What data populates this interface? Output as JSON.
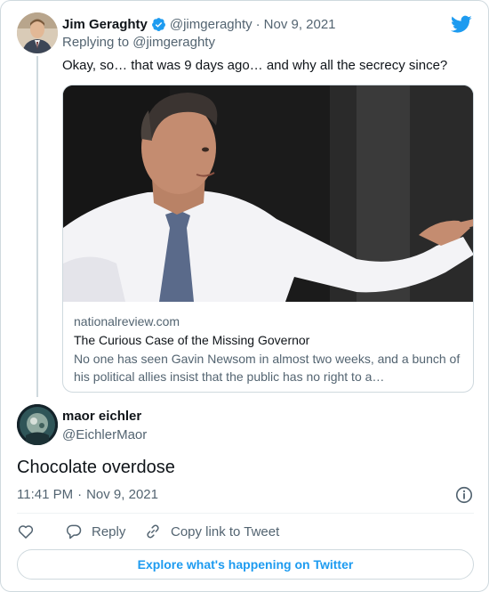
{
  "parent_tweet": {
    "author_name": "Jim Geraghty",
    "author_handle": "@jimgeraghty",
    "separator": "·",
    "date": "Nov 9, 2021",
    "replying_to": "Replying to @jimgeraghty",
    "text": "Okay, so… that was 9 days ago… and why all the secrecy since?",
    "link_card": {
      "domain": "nationalreview.com",
      "title": "The Curious Case of the Missing Governor",
      "description": "No one has seen Gavin Newsom in almost two weeks, and a bunch of his political allies insist that the public has no right to a…"
    }
  },
  "tweet": {
    "author_name": "maor eichler",
    "author_handle": "@EichlerMaor",
    "text": "Chocolate overdose",
    "time": "11:41 PM",
    "separator": "·",
    "date": "Nov 9, 2021"
  },
  "actions": {
    "reply_label": "Reply",
    "copy_label": "Copy link to Tweet"
  },
  "explore_label": "Explore what's happening on Twitter",
  "icons": [
    "twitter-logo-icon",
    "verified-badge-icon",
    "info-icon",
    "heart-icon",
    "reply-bubble-icon",
    "link-icon"
  ],
  "colors": {
    "brand_blue": "#1d9bf0",
    "text_primary": "#0f1419",
    "text_secondary": "#536471",
    "border": "#cfd9de"
  }
}
